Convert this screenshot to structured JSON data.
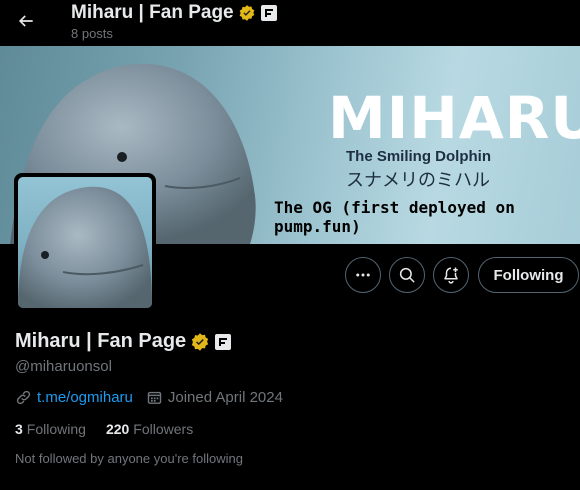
{
  "header": {
    "title": "Miharu | Fan Page",
    "posts": "8 posts"
  },
  "banner": {
    "title": "MIHARU",
    "subtitle": "The Smiling Dolphin",
    "japanese": "スナメリのミハル",
    "tagline": "The OG (first deployed on pump.fun)"
  },
  "actions": {
    "following_label": "Following",
    "more_icon": "more-icon",
    "search_icon": "search-icon",
    "notify_icon": "bell-plus-icon"
  },
  "profile": {
    "name": "Miharu | Fan Page",
    "handle": "@miharuonsol",
    "link": "t.me/ogmiharu",
    "joined": "Joined April 2024",
    "following_count": "3",
    "following_label": "Following",
    "followers_count": "220",
    "followers_label": "Followers",
    "not_followed": "Not followed by anyone you're following"
  },
  "colors": {
    "accent": "#1d9bf0",
    "verified_gold": "#e2b719",
    "muted": "#71767b"
  }
}
